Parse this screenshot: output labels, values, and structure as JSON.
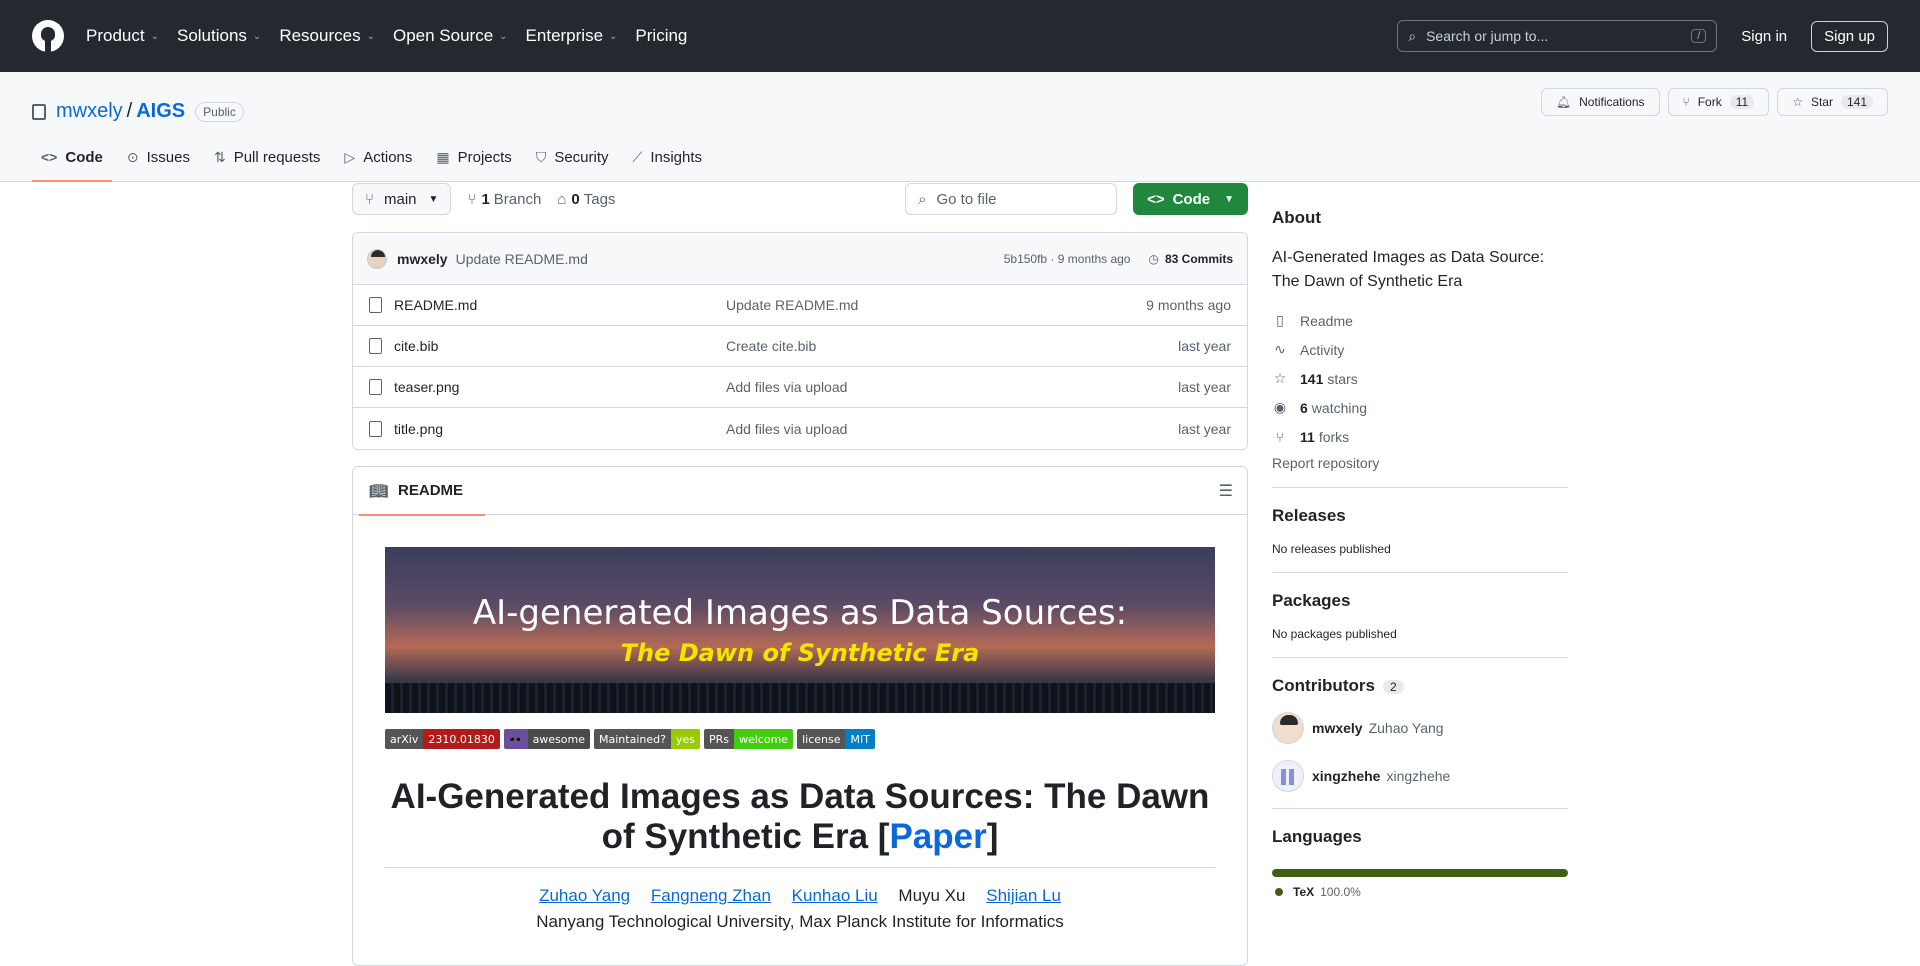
{
  "nav": {
    "items": [
      {
        "label": "Product",
        "chevron": true
      },
      {
        "label": "Solutions",
        "chevron": true
      },
      {
        "label": "Resources",
        "chevron": true
      },
      {
        "label": "Open Source",
        "chevron": true
      },
      {
        "label": "Enterprise",
        "chevron": true
      },
      {
        "label": "Pricing",
        "chevron": false
      }
    ],
    "search_placeholder": "Search or jump to...",
    "search_shortcut": "/",
    "sign_in": "Sign in",
    "sign_up": "Sign up"
  },
  "repo": {
    "owner": "mwxely",
    "separator": "/",
    "name": "AIGS",
    "visibility": "Public",
    "notifications_label": "Notifications",
    "fork_label": "Fork",
    "fork_count": "11",
    "star_label": "Star",
    "star_count": "141"
  },
  "tabs": [
    {
      "label": "Code",
      "icon": "code-icon",
      "active": true
    },
    {
      "label": "Issues",
      "icon": "issue-icon"
    },
    {
      "label": "Pull requests",
      "icon": "pull-request-icon"
    },
    {
      "label": "Actions",
      "icon": "play-icon"
    },
    {
      "label": "Projects",
      "icon": "table-icon"
    },
    {
      "label": "Security",
      "icon": "shield-icon"
    },
    {
      "label": "Insights",
      "icon": "graph-icon"
    }
  ],
  "toolbar": {
    "branch": "main",
    "branches_count": "1",
    "branches_label": "Branch",
    "tags_count": "0",
    "tags_label": "Tags",
    "go_to_file": "Go to file",
    "code_button": "Code"
  },
  "latest_commit": {
    "author": "mwxely",
    "message": "Update README.md",
    "hash_time": "5b150fb · 9 months ago",
    "commits": "83 Commits"
  },
  "files": [
    {
      "name": "README.md",
      "message": "Update README.md",
      "date": "9 months ago"
    },
    {
      "name": "cite.bib",
      "message": "Create cite.bib",
      "date": "last year"
    },
    {
      "name": "teaser.png",
      "message": "Add files via upload",
      "date": "last year"
    },
    {
      "name": "title.png",
      "message": "Add files via upload",
      "date": "last year"
    }
  ],
  "readme": {
    "tab_label": "README",
    "banner_line1": "AI-generated Images as Data Sources:",
    "banner_line2": "The Dawn of Synthetic Era",
    "badges": [
      {
        "left": "arXiv",
        "right": "2310.01830",
        "left_color": "#555555",
        "right_color": "#b31b1b"
      },
      {
        "left": "🕶️",
        "right": "awesome",
        "left_color": "#6b4f9c",
        "right_color": "#4a4a4a"
      },
      {
        "left": "Maintained?",
        "right": "yes",
        "left_color": "#555555",
        "right_color": "#97ca00"
      },
      {
        "left": "PRs",
        "right": "welcome",
        "left_color": "#555555",
        "right_color": "#4c1"
      },
      {
        "left": "license",
        "right": "MIT",
        "left_color": "#555555",
        "right_color": "#007ec6"
      }
    ],
    "title_pre": "AI-Generated Images as Data Sources: The Dawn of Synthetic Era [",
    "title_link": "Paper",
    "title_post": "]",
    "authors": [
      {
        "name": "Zuhao Yang",
        "link": true
      },
      {
        "name": "Fangneng Zhan",
        "link": true
      },
      {
        "name": "Kunhao Liu",
        "link": true
      },
      {
        "name": "Muyu Xu",
        "link": false
      },
      {
        "name": "Shijian Lu",
        "link": true
      }
    ],
    "affiliation": "Nanyang Technological University, Max Planck Institute for Informatics"
  },
  "about": {
    "heading": "About",
    "description": "AI-Generated Images as Data Source: The Dawn of Synthetic Era",
    "readme": "Readme",
    "activity": "Activity",
    "stars_count": "141",
    "stars_label": "stars",
    "watching_count": "6",
    "watching_label": "watching",
    "forks_count": "11",
    "forks_label": "forks",
    "report": "Report repository"
  },
  "releases": {
    "heading": "Releases",
    "text": "No releases published"
  },
  "packages": {
    "heading": "Packages",
    "text": "No packages published"
  },
  "contributors": {
    "heading": "Contributors",
    "count": "2",
    "list": [
      {
        "login": "mwxely",
        "name": "Zuhao Yang"
      },
      {
        "login": "xingzhehe",
        "name": "xingzhehe"
      }
    ]
  },
  "languages": {
    "heading": "Languages",
    "list": [
      {
        "name": "TeX",
        "percent": "100.0%",
        "color": "#3d6117"
      }
    ]
  }
}
